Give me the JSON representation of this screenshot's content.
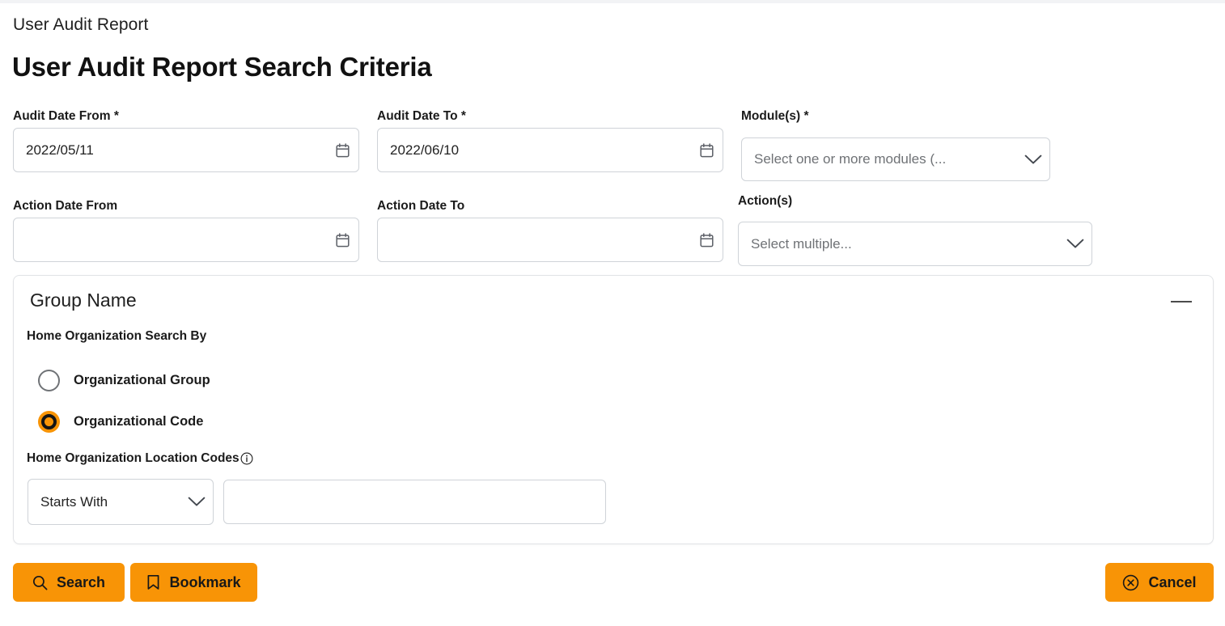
{
  "header": {
    "breadcrumb": "User Audit Report",
    "page_title": "User Audit Report Search Criteria"
  },
  "theme": {
    "accent": "#F89406",
    "border": "#CFD3D8",
    "text": "#1B1B1B",
    "placeholder": "#6F7276"
  },
  "criteria": {
    "audit_date_from": {
      "label": "Audit Date From *",
      "value": "2022/05/11",
      "icon": "calendar-icon"
    },
    "audit_date_to": {
      "label": "Audit Date To *",
      "value": "2022/06/10",
      "icon": "calendar-icon"
    },
    "modules": {
      "label": "Module(s) *",
      "value": "",
      "placeholder": "Select one or more modules (...",
      "icon": "chevron-down-icon"
    },
    "action_date_from": {
      "label": "Action Date From",
      "value": "",
      "placeholder": "",
      "icon": "calendar-icon"
    },
    "action_date_to": {
      "label": "Action Date To",
      "value": "",
      "placeholder": "",
      "icon": "calendar-icon"
    },
    "actions": {
      "label": "Action(s)",
      "value": "",
      "placeholder": "Select multiple...",
      "icon": "chevron-down-icon"
    }
  },
  "group_panel": {
    "title": "Group Name",
    "collapse_icon": "minus-icon",
    "search_by_label": "Home Organization Search By",
    "radios": [
      {
        "label": "Organizational Group",
        "selected": false
      },
      {
        "label": "Organizational Code",
        "selected": true
      }
    ],
    "location_codes": {
      "label": "Home Organization Location Codes",
      "info_icon": "info-icon",
      "operator": {
        "value": "Starts With",
        "icon": "chevron-down-icon"
      },
      "text_value": "",
      "text_placeholder": ""
    }
  },
  "footer": {
    "search": {
      "label": "Search",
      "icon": "search-icon"
    },
    "bookmark": {
      "label": "Bookmark",
      "icon": "bookmark-icon"
    },
    "cancel": {
      "label": "Cancel",
      "icon": "close-circle-icon"
    }
  }
}
